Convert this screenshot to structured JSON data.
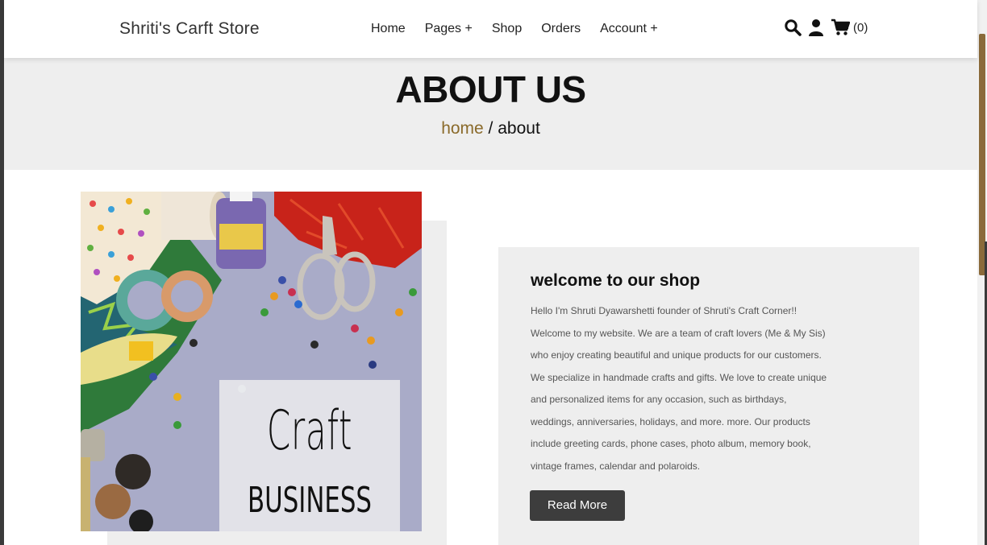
{
  "header": {
    "brand": "Shriti's Carft Store",
    "nav": [
      "Home",
      "Pages +",
      "Shop",
      "Orders",
      "Account +"
    ],
    "icons": [
      "search-icon",
      "user-icon",
      "cart-icon"
    ],
    "cart_count": "(0)"
  },
  "hero": {
    "title": "ABOUT US",
    "breadcrumb_home": "home",
    "breadcrumb_sep": " / ",
    "breadcrumb_current": "about"
  },
  "image": {
    "sign_line1": "Craft",
    "sign_line2": "BUSINESS"
  },
  "about": {
    "heading": "welcome to our shop",
    "body": "Hello I'm Shruti Dyawarshetti founder of Shruti's Craft Corner!! Welcome to my website. We are a team of craft lovers (Me & My Sis) who enjoy creating beautiful and unique products for our customers. We specialize in handmade crafts and gifts. We love to create unique and personalized items for any occasion, such as birthdays, weddings, anniversaries, holidays, and more. more. Our products include greeting cards, phone cases, photo album, memory book, vintage frames, calendar and polaroids.",
    "button": "Read More"
  },
  "colors": {
    "accent": "#8a6a2a",
    "hero_bg": "#eeeeee",
    "button_bg": "#3d3d3d"
  }
}
